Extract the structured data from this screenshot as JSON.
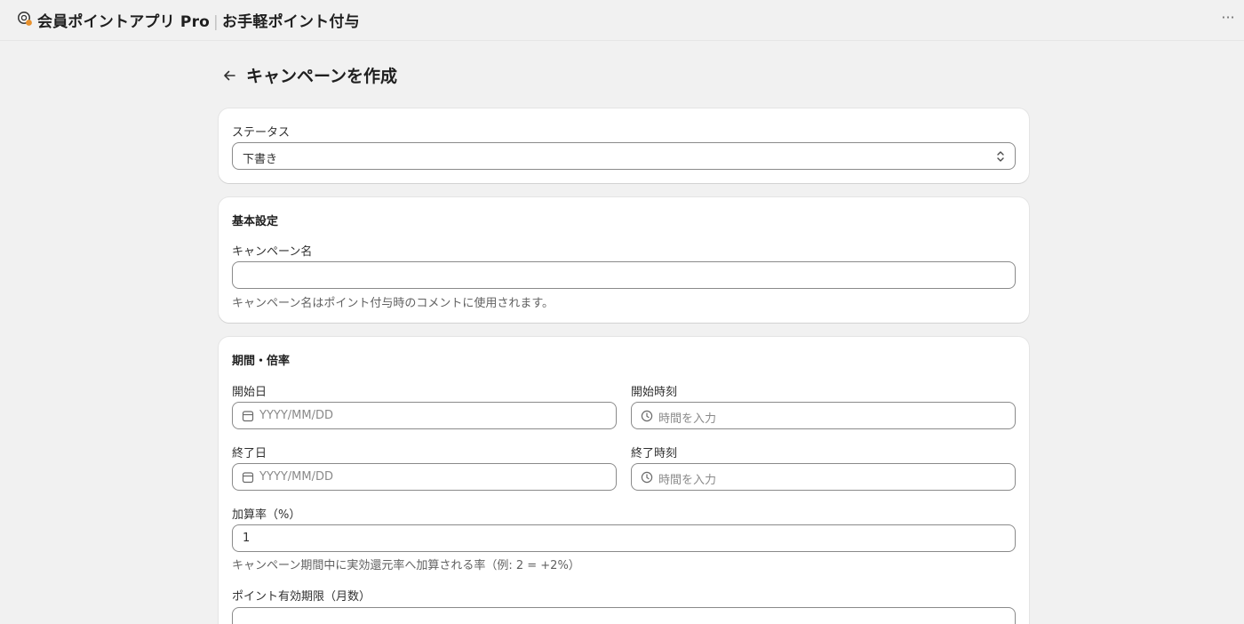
{
  "app": {
    "name": "会員ポイントアプリ Pro",
    "separator": "|",
    "page": "お手軽ポイント付与",
    "more_label": "···"
  },
  "header": {
    "title": "キャンペーンを作成"
  },
  "status": {
    "label": "ステータス",
    "value": "下書き"
  },
  "basic": {
    "title": "基本設定",
    "name_label": "キャンペーン名",
    "name_value": "",
    "name_help": "キャンペーン名はポイント付与時のコメントに使用されます。"
  },
  "period": {
    "title": "期間・倍率",
    "start_date_label": "開始日",
    "start_date_placeholder": "YYYY/MM/DD",
    "start_time_label": "開始時刻",
    "start_time_placeholder": "時間を入力",
    "end_date_label": "終了日",
    "end_date_placeholder": "YYYY/MM/DD",
    "end_time_label": "終了時刻",
    "end_time_placeholder": "時間を入力",
    "rate_label": "加算率（%）",
    "rate_value": "1",
    "rate_help": "キャンペーン期間中に実効還元率へ加算される率（例: 2 = +2%）",
    "expiry_label": "ポイント有効期限（月数）",
    "expiry_value": ""
  },
  "icons": {
    "logo": "app-logo-icon",
    "back": "arrow-left-icon",
    "select": "chevron-up-down-icon",
    "date": "calendar-icon",
    "time": "clock-icon",
    "more": "more-horizontal-icon"
  },
  "colors": {
    "background": "#f1f1f1",
    "card": "#ffffff",
    "border": "#8a8a8a",
    "placeholder": "#8a8a8a",
    "logo_accent": "#e8912d"
  }
}
